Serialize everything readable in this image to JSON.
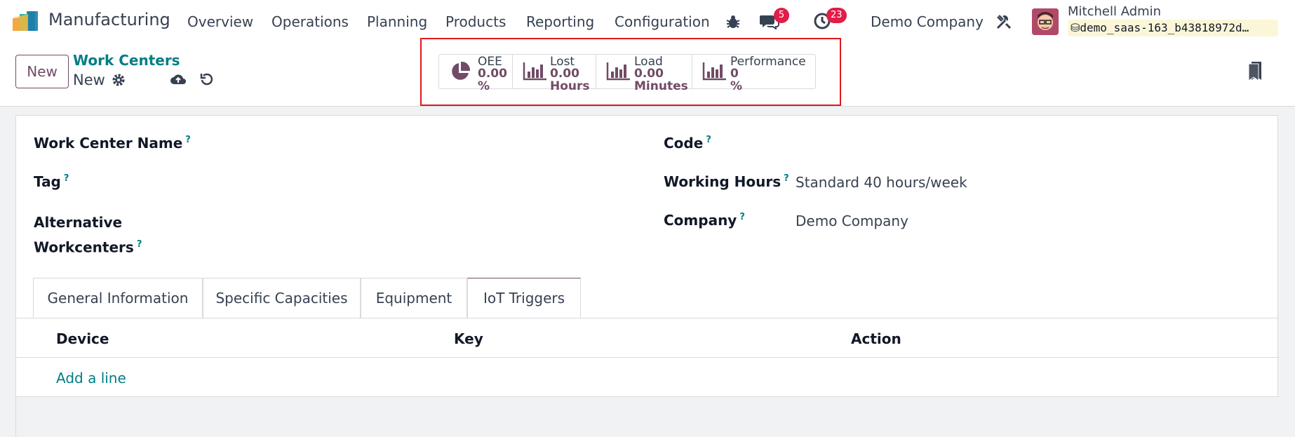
{
  "navbar": {
    "app_name": "Manufacturing",
    "menus": [
      "Overview",
      "Operations",
      "Planning",
      "Products",
      "Reporting",
      "Configuration"
    ],
    "messages_badge": "5",
    "activities_badge": "23",
    "company": "Demo Company",
    "user_name": "Mitchell Admin",
    "database": "demo_saas-163_b43818972d…"
  },
  "control": {
    "new_label": "New",
    "breadcrumb_parent": "Work Centers",
    "breadcrumb_current": "New"
  },
  "stats": {
    "oee": {
      "label": "OEE",
      "value": "0.00",
      "unit": "%"
    },
    "lost": {
      "label": "Lost",
      "value": "0.00",
      "unit": "Hours"
    },
    "load": {
      "label": "Load",
      "value": "0.00",
      "unit": "Minutes"
    },
    "performance": {
      "label": "Performance",
      "value": "0",
      "unit": "%"
    }
  },
  "form": {
    "help_mark": "?",
    "work_center_name_label": "Work Center Name",
    "tag_label": "Tag",
    "alternative_label_1": "Alternative",
    "alternative_label_2": "Workcenters",
    "code_label": "Code",
    "working_hours_label": "Working Hours",
    "working_hours_value": "Standard 40 hours/week",
    "company_label": "Company",
    "company_value": "Demo Company"
  },
  "tabs": [
    "General Information",
    "Specific Capacities",
    "Equipment",
    "IoT Triggers"
  ],
  "active_tab": "IoT Triggers",
  "table": {
    "columns": [
      "Device",
      "Key",
      "Action"
    ],
    "add_line": "Add a line"
  },
  "colors": {
    "brand": "#714b67",
    "link": "#017e84",
    "badge": "#e11d48",
    "highlight": "#e0191b"
  }
}
